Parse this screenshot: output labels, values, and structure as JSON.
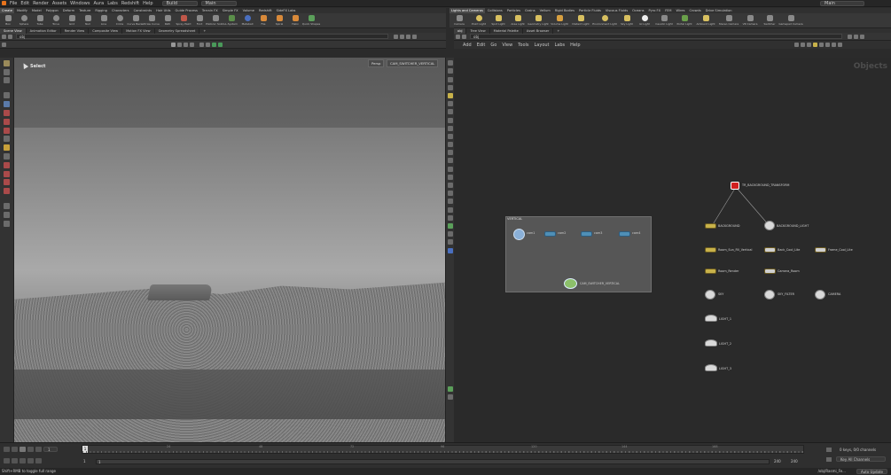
{
  "menubar": {
    "items": [
      "File",
      "Edit",
      "Render",
      "Assets",
      "Windows",
      "Aura",
      "Labs",
      "Redshift",
      "Help"
    ],
    "desktop_left": "Build",
    "desktop_mid": "Main",
    "desktop_right": "Main"
  },
  "left_shelf": {
    "tabs": [
      "Create",
      "Modify",
      "Model",
      "Polygon",
      "Deform",
      "Texture",
      "Rigging",
      "Characters",
      "Constraints",
      "Hair Utils",
      "Guide Process",
      "Terrain FX",
      "Simple FX",
      "Volume",
      "Redshift",
      "SideFX Labs"
    ],
    "tools": [
      "Box",
      "Sphere",
      "Tube",
      "Torus",
      "Grid",
      "Null",
      "Line",
      "Circle",
      "Curve Bezier",
      "Draw Curve",
      "Path",
      "Spray Paint",
      "Font",
      "Platonic Solids",
      "L-System",
      "Metaball",
      "File",
      "Spiral",
      "Helix",
      "Quick Shapes"
    ]
  },
  "right_shelf": {
    "tabs": [
      "Lights and Cameras",
      "Collisions",
      "Particles",
      "Grains",
      "Vellum",
      "Rigid Bodies",
      "Particle Fluids",
      "Viscous Fluids",
      "Oceans",
      "Pyro FX",
      "FEM",
      "Wires",
      "Crowds",
      "Drive Simulation"
    ],
    "tools": [
      "Camera",
      "Point Light",
      "Spot Light",
      "Area Light",
      "Geometry Light",
      "Volume Light",
      "Distant Light",
      "Environment Light",
      "Sky Light",
      "GI Light",
      "Caustic Light",
      "Portal Light",
      "Ambient Light",
      "Stereo Camera",
      "VR Camera",
      "Switcher",
      "Gamepad Camera"
    ]
  },
  "left_panetabs": [
    "Scene View",
    "Animation Editor",
    "Render View",
    "Composite View",
    "Motion FX View",
    "Geometry Spreadsheet"
  ],
  "right_panetabs": [
    "obj",
    "Tree View",
    "Material Palette",
    "Asset Browser"
  ],
  "left_path": "obj",
  "right_path": "obj",
  "viewport": {
    "select_label": "Select",
    "persp_label": "Persp",
    "camera_label": "CAM_SWITCHER_VERTICAL"
  },
  "network": {
    "menu": [
      "Add",
      "Edit",
      "Go",
      "View",
      "Tools",
      "Layout",
      "Labs",
      "Help"
    ],
    "context_label": "Objects",
    "box_title": "VERTICAL",
    "cams": [
      "cam1",
      "cam2",
      "cam3",
      "cam4"
    ],
    "switcher": "CAM_SWITCHER_VERTICAL",
    "transform": "TR_BACKGROUND_TRANSFORM",
    "background": "BACKGROUND",
    "background_light": "BACKGROUND_LIGHT",
    "row2": [
      "Room_Sun_Fill_Vertical",
      "Back_Cool_Lite",
      "Frame_Cool_Lite"
    ],
    "row3": [
      "Room_Render",
      "Camera_Room"
    ],
    "row4": [
      "SKY",
      "SKY_FILTER",
      "CAMERA"
    ],
    "lights": [
      "LIGHT_1",
      "LIGHT_2",
      "LIGHT_3"
    ]
  },
  "timeline": {
    "frame": "1",
    "start": "1",
    "end": "1",
    "range_end": "240",
    "range_end2": "240",
    "ticks": [
      "1",
      "24",
      "48",
      "72",
      "96",
      "120",
      "144",
      "168",
      "192",
      "216",
      "240"
    ],
    "keys_label": "0 keys, 0/0 channels",
    "key_all": "Key All Channels",
    "auto_update": "Auto Update",
    "obj_path": "/obj/Rasmi_Fe..."
  },
  "status": {
    "text": "Shift+RMB to toggle full range"
  }
}
